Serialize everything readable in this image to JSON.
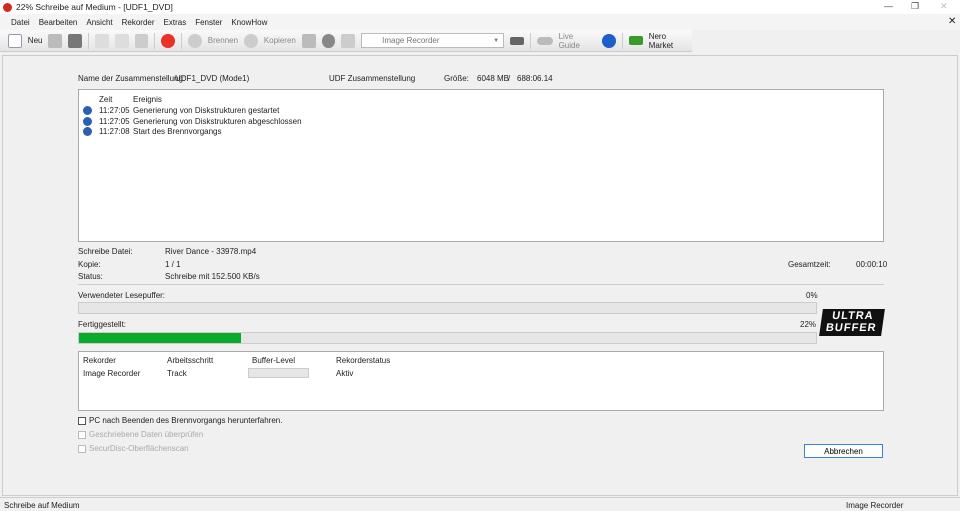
{
  "window": {
    "title": "22% Schreibe auf Medium - [UDF1_DVD]",
    "close": "✕"
  },
  "menu": [
    "Datei",
    "Bearbeiten",
    "Ansicht",
    "Rekorder",
    "Extras",
    "Fenster",
    "KnowHow"
  ],
  "toolbar": {
    "new": "Neu",
    "burn": "Brennen",
    "copy": "Kopieren",
    "recorder": "Image Recorder",
    "live_guide": "Live Guide",
    "market": "Nero Market"
  },
  "compilation": {
    "name_label": "Name der Zusammenstellung:",
    "name": "UDF1_DVD (Mode1)",
    "type": "UDF Zusammenstellung",
    "size_label": "Größe:",
    "size": "6048 MB",
    "sep": "/",
    "duration": "688:06.14"
  },
  "log": {
    "headers": [
      "Zeit",
      "Ereignis"
    ],
    "rows": [
      {
        "time": "11:27:05",
        "event": "Generierung von Diskstrukturen gestartet"
      },
      {
        "time": "11:27:05",
        "event": "Generierung von Diskstrukturen abgeschlossen"
      },
      {
        "time": "11:27:08",
        "event": "Start des Brennvorgangs"
      }
    ]
  },
  "details": {
    "file_label": "Schreibe Datei:",
    "file": "River Dance - 33978.mp4",
    "copy_label": "Kopie:",
    "copy": "1 / 1",
    "status_label": "Status:",
    "status": "Schreibe mit 152.500 KB/s",
    "total_label": "Gesamtzeit:",
    "total": "00:00:10"
  },
  "buffer": {
    "label": "Verwendeter Lesepuffer:",
    "percent_text": "0%",
    "value": 0
  },
  "progress": {
    "label": "Fertiggestellt:",
    "percent_text": "22%",
    "value": 22,
    "color": "#0aab2b"
  },
  "logo": "ULTRA BUFFER",
  "recorders": {
    "headers": [
      "Rekorder",
      "Arbeitsschritt",
      "Buffer-Level",
      "Rekorderstatus"
    ],
    "rows": [
      {
        "name": "Image Recorder",
        "step": "Track",
        "status": "Aktiv"
      }
    ]
  },
  "options": [
    "PC nach Beenden des Brennvorgangs herunterfahren.",
    "Geschriebene Daten überprüfen",
    "SecurDisc-Oberflächenscan"
  ],
  "cancel": "Abbrechen",
  "statusbar": {
    "left": "Schreibe auf Medium",
    "right": "Image Recorder"
  }
}
